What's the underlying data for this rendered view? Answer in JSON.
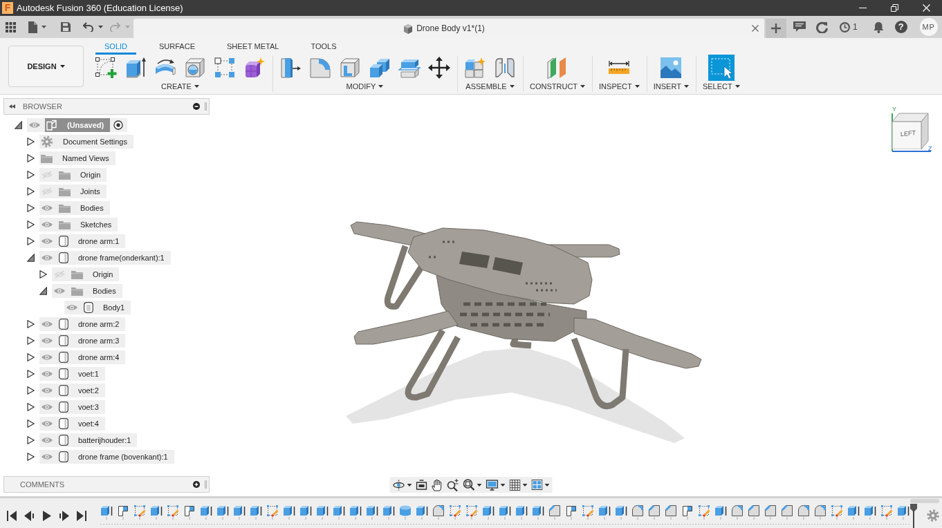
{
  "window": {
    "app_logo": "F",
    "title": "Autodesk Fusion 360 (Education License)"
  },
  "quick_access": {
    "undo": {
      "disabled": false
    },
    "redo": {
      "disabled": true
    }
  },
  "document_tab": {
    "title": "Drone Body v1*(1)"
  },
  "account_bar": {
    "job_count": "1",
    "help": "?",
    "user_initials": "MP"
  },
  "ribbon": {
    "workspace": "DESIGN",
    "tabs": [
      {
        "label": "SOLID",
        "selected": true
      },
      {
        "label": "SURFACE",
        "selected": false
      },
      {
        "label": "SHEET METAL",
        "selected": false
      },
      {
        "label": "TOOLS",
        "selected": false
      }
    ],
    "groups": [
      {
        "label": "CREATE"
      },
      {
        "label": "MODIFY"
      },
      {
        "label": "ASSEMBLE"
      },
      {
        "label": "CONSTRUCT"
      },
      {
        "label": "INSPECT"
      },
      {
        "label": "INSERT"
      },
      {
        "label": "SELECT"
      }
    ]
  },
  "browser": {
    "title": "BROWSER",
    "tree": [
      {
        "label": "(Unsaved)",
        "kind": "root",
        "expanded": true,
        "visible": true,
        "active": true,
        "children": [
          {
            "label": "Document Settings",
            "kind": "settings",
            "expanded": false
          },
          {
            "label": "Named Views",
            "kind": "folder",
            "expanded": false
          },
          {
            "label": "Origin",
            "kind": "folder",
            "expanded": false,
            "visible": false
          },
          {
            "label": "Joints",
            "kind": "folder",
            "expanded": false,
            "visible": false
          },
          {
            "label": "Bodies",
            "kind": "folder",
            "expanded": false,
            "visible": true
          },
          {
            "label": "Sketches",
            "kind": "folder",
            "expanded": false,
            "visible": true
          },
          {
            "label": "drone arm:1",
            "kind": "component",
            "expanded": false,
            "visible": true
          },
          {
            "label": "drone frame(onderkant):1",
            "kind": "component",
            "expanded": true,
            "visible": true,
            "children": [
              {
                "label": "Origin",
                "kind": "folder",
                "expanded": false,
                "visible": false
              },
              {
                "label": "Bodies",
                "kind": "folder",
                "expanded": true,
                "visible": true,
                "children": [
                  {
                    "label": "Body1",
                    "kind": "body",
                    "visible": true
                  }
                ]
              }
            ]
          },
          {
            "label": "drone arm:2",
            "kind": "component",
            "expanded": false,
            "visible": true
          },
          {
            "label": "drone arm:3",
            "kind": "component",
            "expanded": false,
            "visible": true
          },
          {
            "label": "drone arm:4",
            "kind": "component",
            "expanded": false,
            "visible": true
          },
          {
            "label": "voet:1",
            "kind": "component",
            "expanded": false,
            "visible": true
          },
          {
            "label": "voet:2",
            "kind": "component",
            "expanded": false,
            "visible": true
          },
          {
            "label": "voet:3",
            "kind": "component",
            "expanded": false,
            "visible": true
          },
          {
            "label": "voet:4",
            "kind": "component",
            "expanded": false,
            "visible": true
          },
          {
            "label": "batterijhouder:1",
            "kind": "component",
            "expanded": false,
            "visible": true
          },
          {
            "label": "drone frame (bovenkant):1",
            "kind": "component",
            "expanded": false,
            "visible": true
          }
        ]
      }
    ]
  },
  "view_cube": {
    "face": "LEFT",
    "axes": [
      "Y",
      "Z"
    ]
  },
  "comments": {
    "title": "COMMENTS"
  }
}
